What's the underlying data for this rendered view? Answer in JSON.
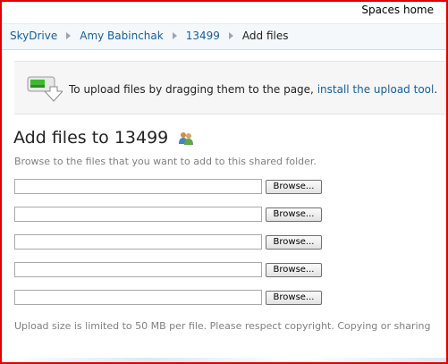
{
  "header": {
    "spaces_home": "Spaces home"
  },
  "breadcrumb": {
    "items": [
      "SkyDrive",
      "Amy Babinchak",
      "13499"
    ],
    "current": "Add files"
  },
  "banner": {
    "text": "To upload files by dragging them to the page, ",
    "link": "install the upload tool",
    "suffix": ".",
    "icon": "upload-tool-icon"
  },
  "main": {
    "title": "Add files to 13499",
    "title_icon": "shared-folder-icon",
    "description": "Browse to the files that you want to add to this shared folder.",
    "browse_label": "Browse...",
    "file_inputs": [
      "",
      "",
      "",
      "",
      ""
    ],
    "footnote": "Upload size is limited to 50 MB per file. Please respect copyright. Copying or sharing"
  },
  "colors": {
    "border": "#e00000",
    "link": "#1a5d95",
    "muted": "#808080"
  }
}
